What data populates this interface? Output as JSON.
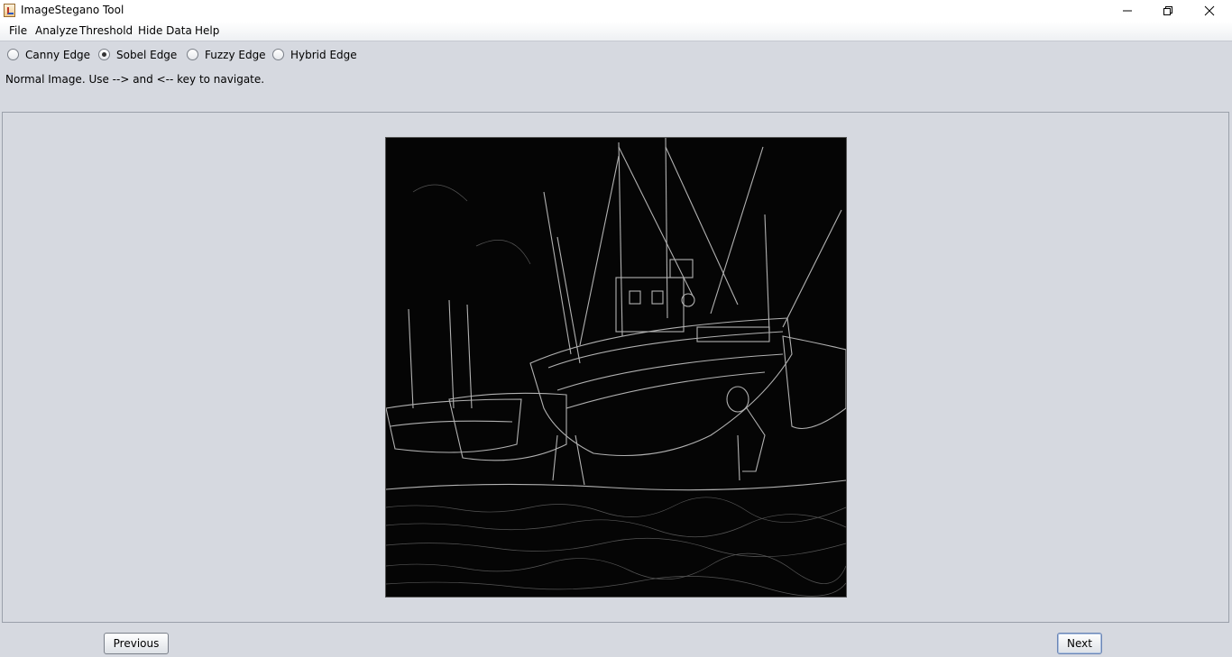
{
  "window": {
    "title": "ImageStegano Tool",
    "app_icon": "java-cup-icon",
    "controls": [
      "minimize-icon",
      "restore-icon",
      "close-icon"
    ]
  },
  "menu": {
    "items": [
      "File",
      "Analyze",
      "Threshold",
      "Hide Data",
      "Help"
    ]
  },
  "edge_options": {
    "items": [
      {
        "label": "Canny Edge",
        "selected": false
      },
      {
        "label": "Sobel Edge",
        "selected": true
      },
      {
        "label": "Fuzzy Edge",
        "selected": false
      },
      {
        "label": "Hybrid Edge",
        "selected": false
      }
    ]
  },
  "status": {
    "text": "Normal Image. Use --> and <-- key to navigate."
  },
  "viewer": {
    "image": "sobel-edge-boats-image"
  },
  "nav": {
    "previous_label": "Previous",
    "next_label": "Next"
  }
}
